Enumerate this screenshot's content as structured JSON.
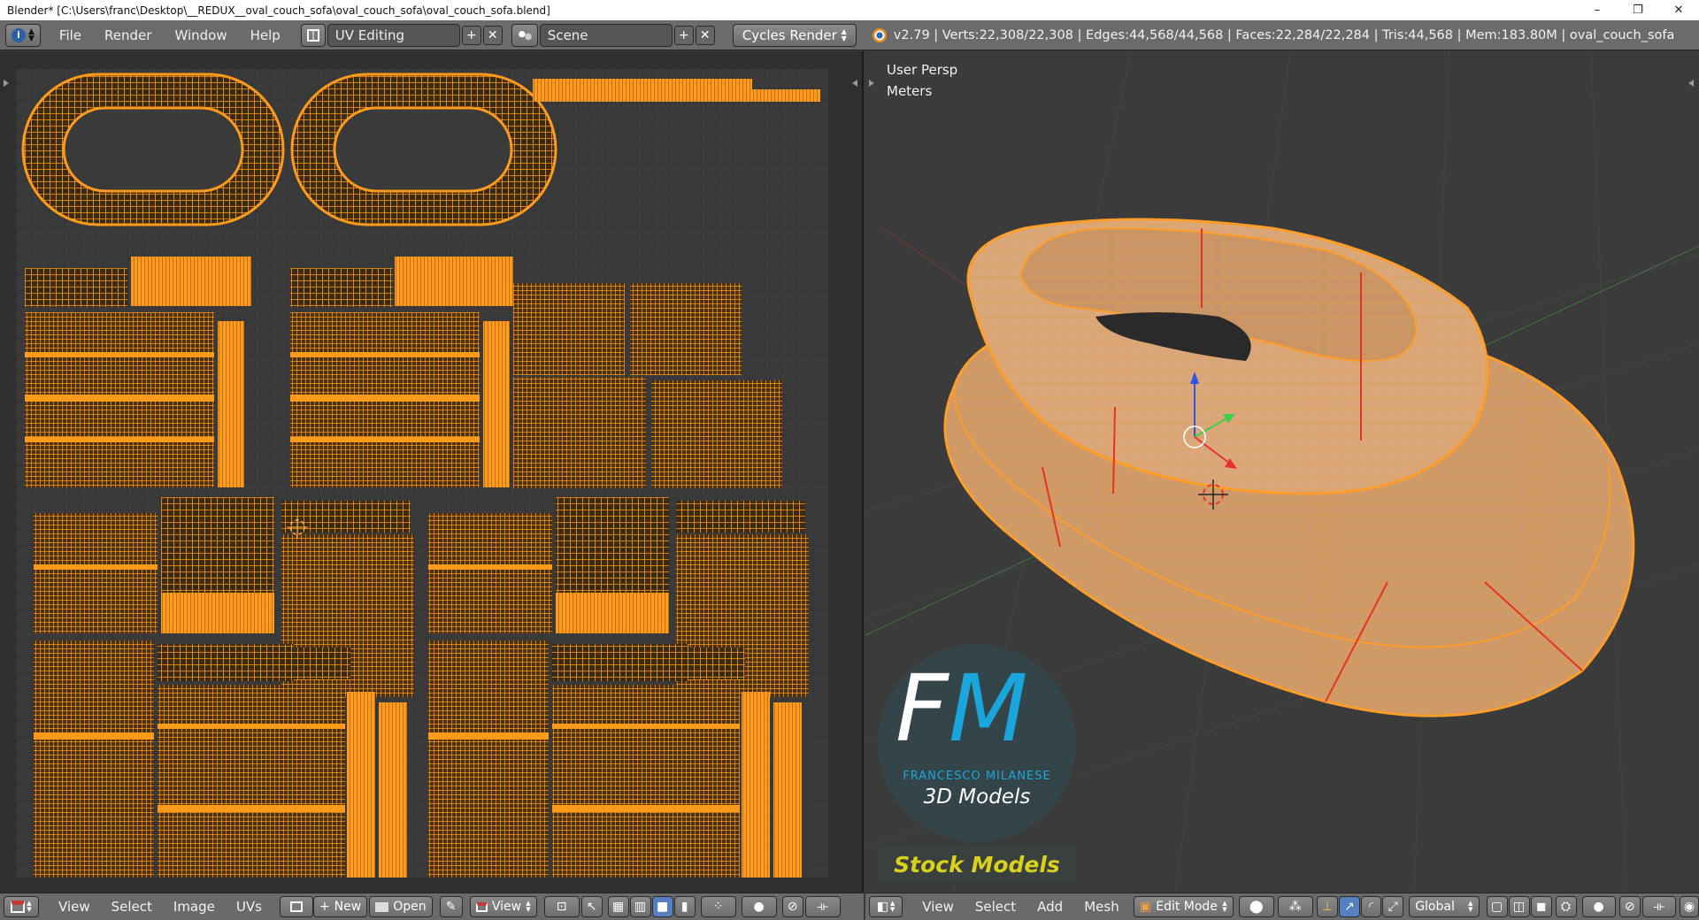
{
  "window": {
    "title": "Blender* [C:\\Users\\franc\\Desktop\\__REDUX__oval_couch_sofa\\oval_couch_sofa\\oval_couch_sofa.blend]",
    "minimize": "–",
    "restore": "❐",
    "close": "✕"
  },
  "infobar": {
    "menus": [
      "File",
      "Render",
      "Window",
      "Help"
    ],
    "layout": "UV Editing",
    "scene": "Scene",
    "engine": "Cycles Render",
    "stats": "v2.79 | Verts:22,308/22,308 | Edges:44,568/44,568 | Faces:22,284/22,284 | Tris:44,568 | Mem:183.80M | oval_couch_sofa",
    "add_icon": "plus-icon",
    "close_icon": "x-icon"
  },
  "viewport": {
    "view_name": "User Persp",
    "units": "Meters"
  },
  "watermark": {
    "letters_f": "F",
    "letters_m": "M",
    "name": "FRANCESCO MILANESE",
    "subtitle": "3D Models",
    "banner": "Stock Models"
  },
  "uv_footer": {
    "menus": [
      "View",
      "Select",
      "Image",
      "UVs"
    ],
    "new_label": "New",
    "open_label": "Open",
    "view_label": "View"
  },
  "view3d_footer": {
    "menus": [
      "View",
      "Select",
      "Add",
      "Mesh"
    ],
    "mode": "Edit Mode",
    "orientation": "Global"
  },
  "colors": {
    "uv_orange": "#ff9a1a",
    "uv_grid_bg": "#3a3a3a",
    "mesh_fill": "#d9a77a",
    "wire": "#ff9d2a",
    "seam": "#e8321e",
    "accent_blue": "#1aa6dc",
    "banner_yellow": "#d8d21a"
  }
}
